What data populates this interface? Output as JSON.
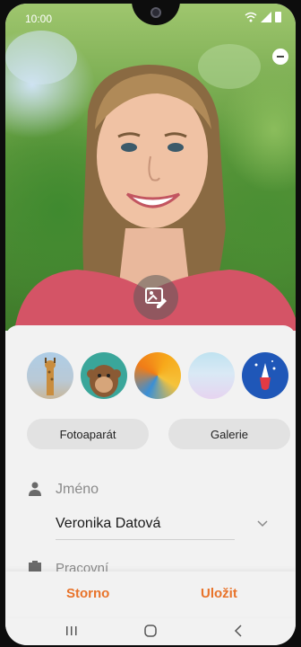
{
  "status_bar": {
    "time": "10:00"
  },
  "icons": {
    "remove_photo": "minus-circle-icon",
    "edit_photo": "image-edit-icon",
    "name_field": "person-icon",
    "work_field": "building-icon",
    "expand": "chevron-down-icon"
  },
  "photo_actions": {
    "camera_label": "Fotoaparát",
    "gallery_label": "Galerie"
  },
  "fields": {
    "name_label": "Jméno",
    "name_value": "Veronika Datová",
    "work_label": "Pracovní"
  },
  "actions": {
    "cancel_label": "Storno",
    "save_label": "Uložit"
  },
  "colors": {
    "accent": "#e8732a"
  }
}
